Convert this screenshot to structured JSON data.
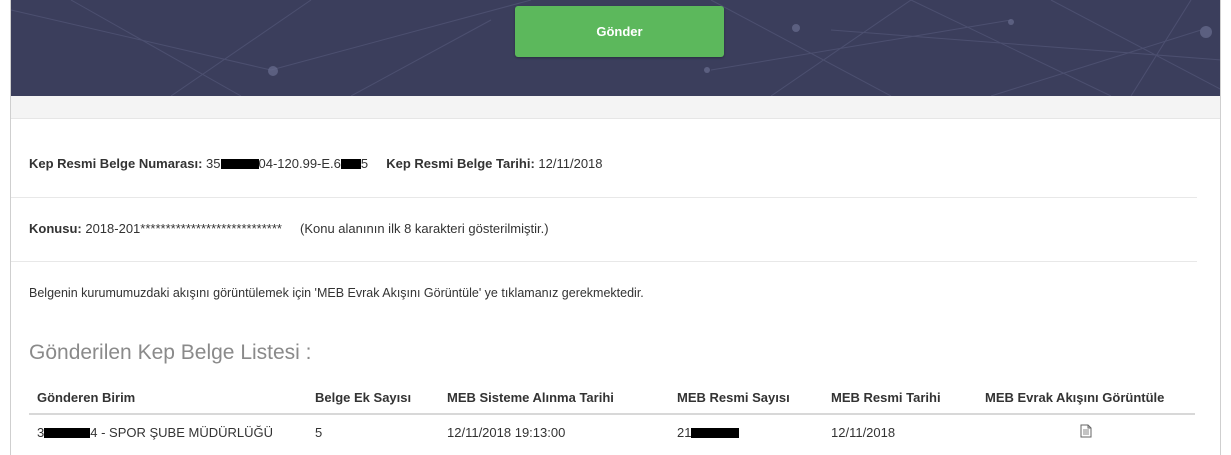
{
  "header": {
    "send_button_label": "Gönder",
    "banner_color": "#3b3e5c",
    "button_color": "#5cb85c"
  },
  "info": {
    "number_label": "Kep Resmi Belge Numarası:",
    "number_prefix": "35",
    "number_middle": "04-120.99-E.6",
    "number_suffix": "5",
    "date_label": "Kep Resmi Belge Tarihi:",
    "date_value": "12/11/2018",
    "subject_label": "Konusu:",
    "subject_value": "2018-201****************************",
    "subject_note": "(Konu alanının ilk 8 karakteri gösterilmiştir.)",
    "instruction": "Belgenin kurumumuzdaki akışını görüntülemek için 'MEB Evrak Akışını Görüntüle' ye tıklamanız gerekmektedir."
  },
  "list": {
    "title": "Gönderilen Kep Belge Listesi :",
    "columns": [
      "Gönderen Birim",
      "Belge Ek Sayısı",
      "MEB Sisteme Alınma Tarihi",
      "MEB Resmi Sayısı",
      "MEB Resmi Tarihi",
      "MEB Evrak Akışını Görüntüle"
    ],
    "rows": [
      {
        "sender_prefix": "3",
        "sender_suffix": "4 - SPOR ŞUBE MÜDÜRLÜĞÜ",
        "attachment_count": "5",
        "received_date": "12/11/2018 19:13:00",
        "official_number_prefix": "21",
        "official_date": "12/11/2018",
        "view_icon": "document-icon"
      }
    ]
  }
}
